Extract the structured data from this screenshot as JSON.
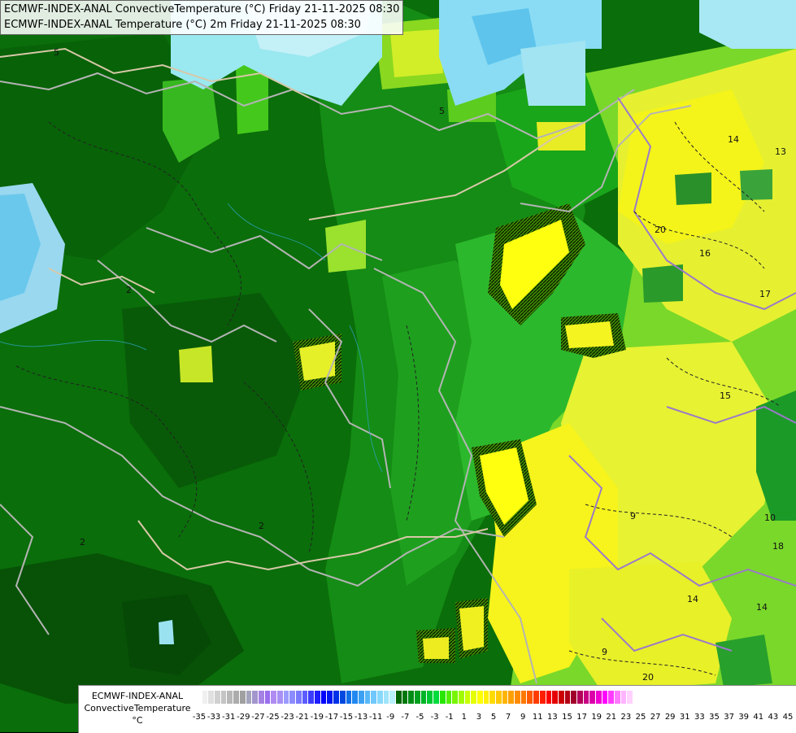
{
  "title": {
    "line1": "ECMWF-INDEX-ANAL ConvectiveTemperature (°C) Friday 21-11-2025 08:30",
    "line2": "ECMWF-INDEX-ANAL Temperature (°C) 2m Friday 21-11-2025 08:30"
  },
  "legend": {
    "line1": "ECMWF-INDEX-ANAL",
    "line2": "ConvectiveTemperature",
    "line3": "°C",
    "ticks": [
      "-35",
      "-33",
      "-31",
      "-29",
      "-27",
      "-25",
      "-23",
      "-21",
      "-19",
      "-17",
      "-15",
      "-13",
      "-11",
      "-9",
      "-7",
      "-5",
      "-3",
      "-1",
      "1",
      "3",
      "5",
      "7",
      "9",
      "11",
      "13",
      "15",
      "17",
      "19",
      "21",
      "23",
      "25",
      "27",
      "29",
      "31",
      "33",
      "35",
      "37",
      "39",
      "41",
      "43",
      "45"
    ],
    "colors": [
      "#ffffff",
      "#f0f0f0",
      "#e0e0e0",
      "#d0d0d0",
      "#c4c4c4",
      "#b8b8b8",
      "#acacac",
      "#a0a0a0",
      "#a4a4bc",
      "#a296cc",
      "#a482e4",
      "#9a6eee",
      "#b08cf2",
      "#a890f4",
      "#9c9cff",
      "#8c8cff",
      "#7a7aff",
      "#5c5cff",
      "#3c3cff",
      "#1e1eff",
      "#0000ff",
      "#0018f0",
      "#0030e8",
      "#0048e0",
      "#1070e8",
      "#2088f0",
      "#3ca0f4",
      "#58b8f8",
      "#70c8fc",
      "#88d8fc",
      "#a0e4fc",
      "#b8f0fc",
      "#006400",
      "#00780a",
      "#008c14",
      "#00a01e",
      "#00b428",
      "#00c832",
      "#00dc3c",
      "#28e600",
      "#50f000",
      "#78f500",
      "#a0fa00",
      "#c8ff00",
      "#e6ff00",
      "#ffff00",
      "#fff000",
      "#ffdc00",
      "#ffc800",
      "#ffb400",
      "#ffa000",
      "#ff8c00",
      "#ff7800",
      "#ff5a00",
      "#ff3c00",
      "#ff1e00",
      "#ff0000",
      "#e60000",
      "#cc0000",
      "#b40014",
      "#a0002a",
      "#b4005a",
      "#c80082",
      "#dc00aa",
      "#f000d2",
      "#ff00ff",
      "#ff3cff",
      "#ff78ff",
      "#ffb4ff",
      "#ffd2ff"
    ]
  },
  "contour_labels": [
    "5",
    "5",
    "2",
    "2",
    "2",
    "20",
    "15",
    "16",
    "17",
    "13",
    "14",
    "14",
    "9",
    "9",
    "20",
    "18",
    "10",
    "14"
  ]
}
